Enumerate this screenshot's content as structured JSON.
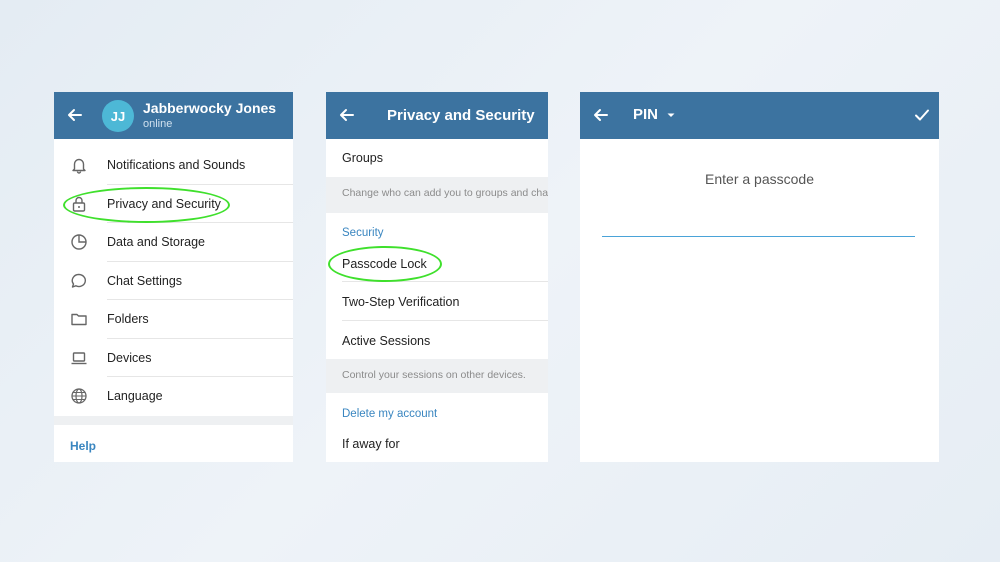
{
  "panel1": {
    "user_name": "Jabberwocky Jones",
    "user_status": "online",
    "avatar_initials": "JJ",
    "menu": [
      {
        "label": "Notifications and Sounds",
        "icon": "bell-icon"
      },
      {
        "label": "Privacy and Security",
        "icon": "lock-icon"
      },
      {
        "label": "Data and Storage",
        "icon": "pie-chart-icon"
      },
      {
        "label": "Chat Settings",
        "icon": "chat-bubble-icon"
      },
      {
        "label": "Folders",
        "icon": "folder-icon"
      },
      {
        "label": "Devices",
        "icon": "laptop-icon"
      },
      {
        "label": "Language",
        "icon": "globe-icon"
      }
    ],
    "help_label": "Help"
  },
  "panel2": {
    "title": "Privacy and Security",
    "groups_label": "Groups",
    "groups_note": "Change who can add you to groups and cha",
    "security_section": "Security",
    "passcode_label": "Passcode Lock",
    "two_step_label": "Two-Step Verification",
    "sessions_label": "Active Sessions",
    "sessions_note": "Control your sessions on other devices.",
    "delete_section": "Delete my account",
    "away_label": "If away for"
  },
  "panel3": {
    "title": "PIN",
    "prompt": "Enter a passcode"
  },
  "colors": {
    "header": "#3c73a0",
    "accent": "#3a86c0",
    "highlight_ring": "#3fe02c"
  }
}
